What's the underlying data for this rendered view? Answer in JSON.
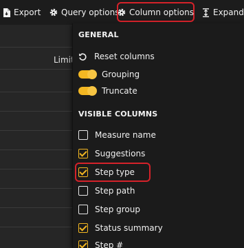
{
  "toolbar": {
    "export_label": "Export",
    "query_options_label": "Query options",
    "column_options_label": "Column options",
    "expand_label": "Expand"
  },
  "table": {
    "limit_header": "Limit"
  },
  "column_options_menu": {
    "general_title": "GENERAL",
    "reset_columns_label": "Reset columns",
    "grouping_label": "Grouping",
    "grouping_on": true,
    "truncate_label": "Truncate",
    "truncate_on": true,
    "visible_columns_title": "VISIBLE COLUMNS",
    "columns": [
      {
        "label": "Measure name",
        "checked": false
      },
      {
        "label": "Suggestions",
        "checked": true
      },
      {
        "label": "Step type",
        "checked": true
      },
      {
        "label": "Step path",
        "checked": false
      },
      {
        "label": "Step group",
        "checked": false
      },
      {
        "label": "Status summary",
        "checked": true
      },
      {
        "label": "Step #",
        "checked": true
      }
    ]
  },
  "colors": {
    "accent": "#f3b722",
    "highlight": "#d6222a",
    "panel_bg": "#1b1b1b",
    "toolbar_bg": "#1c1c1c"
  }
}
